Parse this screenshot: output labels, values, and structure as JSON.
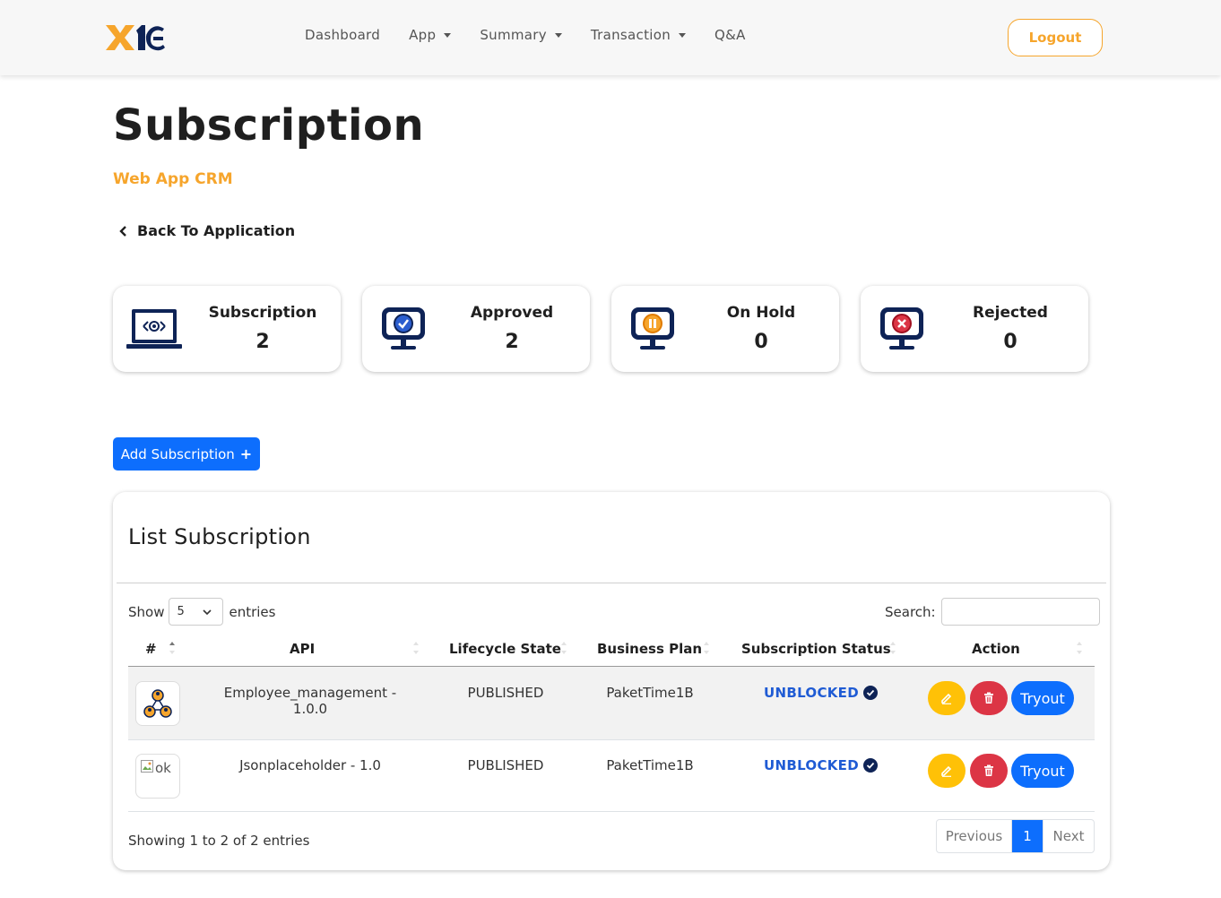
{
  "nav": {
    "items": [
      {
        "label": "Dashboard",
        "dropdown": false
      },
      {
        "label": "App",
        "dropdown": true
      },
      {
        "label": "Summary",
        "dropdown": true
      },
      {
        "label": "Transaction",
        "dropdown": true
      },
      {
        "label": "Q&A",
        "dropdown": false
      }
    ],
    "logout_label": "Logout"
  },
  "header": {
    "title": "Subscription",
    "subtitle": "Web App CRM",
    "back_label": "Back To Application"
  },
  "stats": [
    {
      "label": "Subscription",
      "count": "2",
      "icon": "laptop-code-icon"
    },
    {
      "label": "Approved",
      "count": "2",
      "icon": "monitor-check-icon"
    },
    {
      "label": "On Hold",
      "count": "0",
      "icon": "monitor-pause-icon"
    },
    {
      "label": "Rejected",
      "count": "0",
      "icon": "monitor-x-icon"
    }
  ],
  "add_button_label": "Add Subscription",
  "list": {
    "title": "List Subscription",
    "show_label": "Show",
    "entries_label": "entries",
    "page_size": "5",
    "search_label": "Search:",
    "search_value": "",
    "columns": [
      "#",
      "API",
      "Lifecycle State",
      "Business Plan",
      "Subscription Status",
      "Action"
    ],
    "rows": [
      {
        "api": "Employee_management - 1.0.0",
        "lifecycle": "PUBLISHED",
        "plan": "PaketTime1B",
        "status": "UNBLOCKED",
        "image": "network-icon"
      },
      {
        "api": "Jsonplaceholder - 1.0",
        "lifecycle": "PUBLISHED",
        "plan": "PaketTime1B",
        "status": "UNBLOCKED",
        "image_alt": "ok"
      }
    ],
    "tryout_label": "Tryout",
    "info": "Showing 1 to 2 of 2 entries",
    "pagination": {
      "previous": "Previous",
      "current": "1",
      "next": "Next"
    }
  },
  "colors": {
    "accent": "#f6a52c",
    "primary": "#0d6efd",
    "navy": "#0e2356",
    "danger": "#dc3545",
    "warning": "#ffc107",
    "status_blue": "#1f5bd4"
  }
}
